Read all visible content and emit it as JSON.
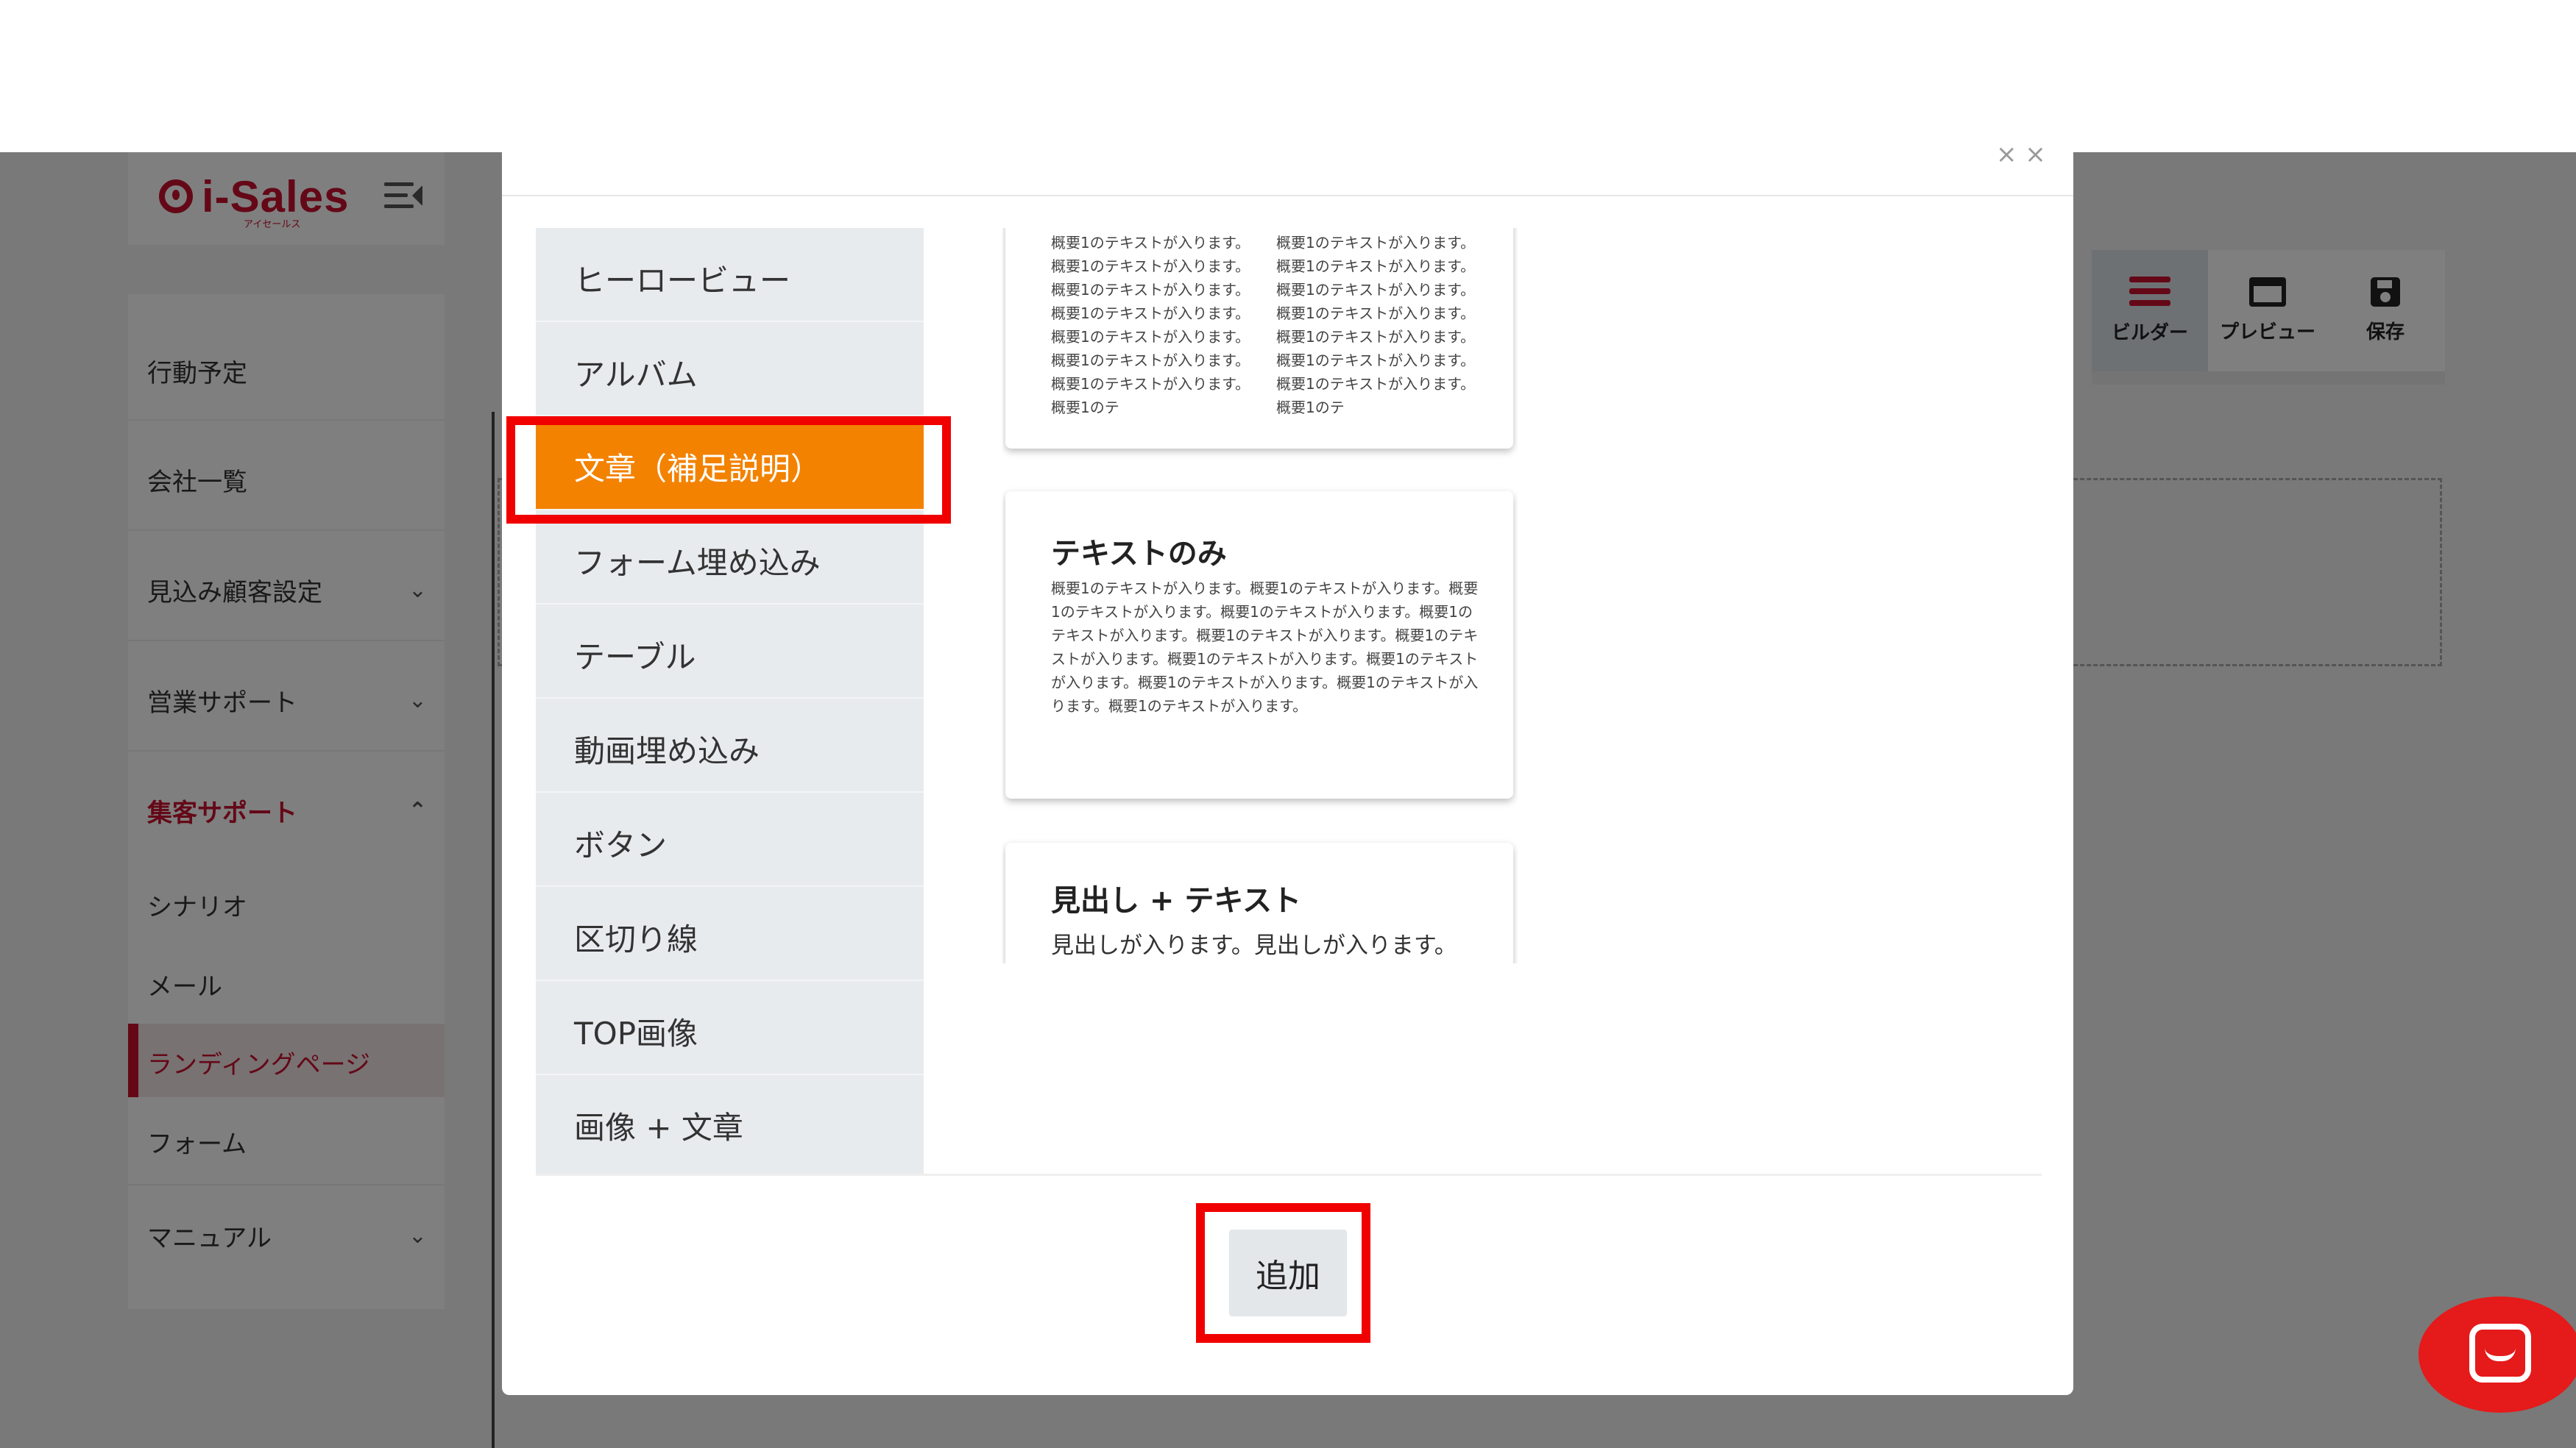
{
  "app": {
    "logo_text": "i-Sales",
    "logo_sub": "アイセールス"
  },
  "sidebar": {
    "items": [
      {
        "label": "行動予定"
      },
      {
        "label": "会社一覧"
      },
      {
        "label": "見込み顧客設定",
        "chevron": "⌄"
      },
      {
        "label": "営業サポート",
        "chevron": "⌄"
      },
      {
        "label": "集客サポート",
        "chevron": "⌃"
      },
      {
        "label": "シナリオ"
      },
      {
        "label": "メール"
      },
      {
        "label": "ランディングページ"
      },
      {
        "label": "フォーム"
      },
      {
        "label": "マニュアル",
        "chevron": "⌄"
      }
    ]
  },
  "toolbar": {
    "builder": "ビルダー",
    "preview": "プレビュー",
    "save": "保存"
  },
  "modal": {
    "close_glyph": "× ×",
    "categories": [
      "ヒーロービュー",
      "アルバム",
      "文章（補足説明）",
      "フォーム埋め込み",
      "テーブル",
      "動画埋め込み",
      "ボタン",
      "区切り線",
      "TOP画像",
      "画像 + 文章"
    ],
    "selected_category": "文章（補足説明）",
    "templates": {
      "two_column": {
        "col1": "概要1のテキストが入ります。概要1のテキストが入ります。概要1のテキストが入ります。概要1のテキストが入ります。概要1のテキストが入ります。概要1のテキストが入ります。概要1のテキストが入ります。概要1のテ",
        "col2": "概要1のテキストが入ります。概要1のテキストが入ります。概要1のテキストが入ります。概要1のテキストが入ります。概要1のテキストが入ります。概要1のテキストが入ります。概要1のテキストが入ります。概要1のテ"
      },
      "text_only": {
        "title": "テキストのみ",
        "body": "概要1のテキストが入ります。概要1のテキストが入ります。概要1のテキストが入ります。概要1のテキストが入ります。概要1のテキストが入ります。概要1のテキストが入ります。概要1のテキストが入ります。概要1のテキストが入ります。概要1のテキストが入ります。概要1のテキストが入ります。概要1のテキストが入ります。概要1のテキストが入ります。"
      },
      "heading_text": {
        "title": "見出し + テキスト",
        "subtitle": "見出しが入ります。見出しが入ります。"
      }
    },
    "add_button": "追加"
  },
  "colors": {
    "brand_red": "#c8102e",
    "selected_orange": "#f38200",
    "highlight_red": "#f10000",
    "chat_red": "#e51a1a"
  },
  "icons": [
    "menu-collapse-icon",
    "chevron-down-icon",
    "chevron-up-icon",
    "builder-icon",
    "preview-icon",
    "save-icon",
    "close-icon",
    "chat-icon"
  ]
}
